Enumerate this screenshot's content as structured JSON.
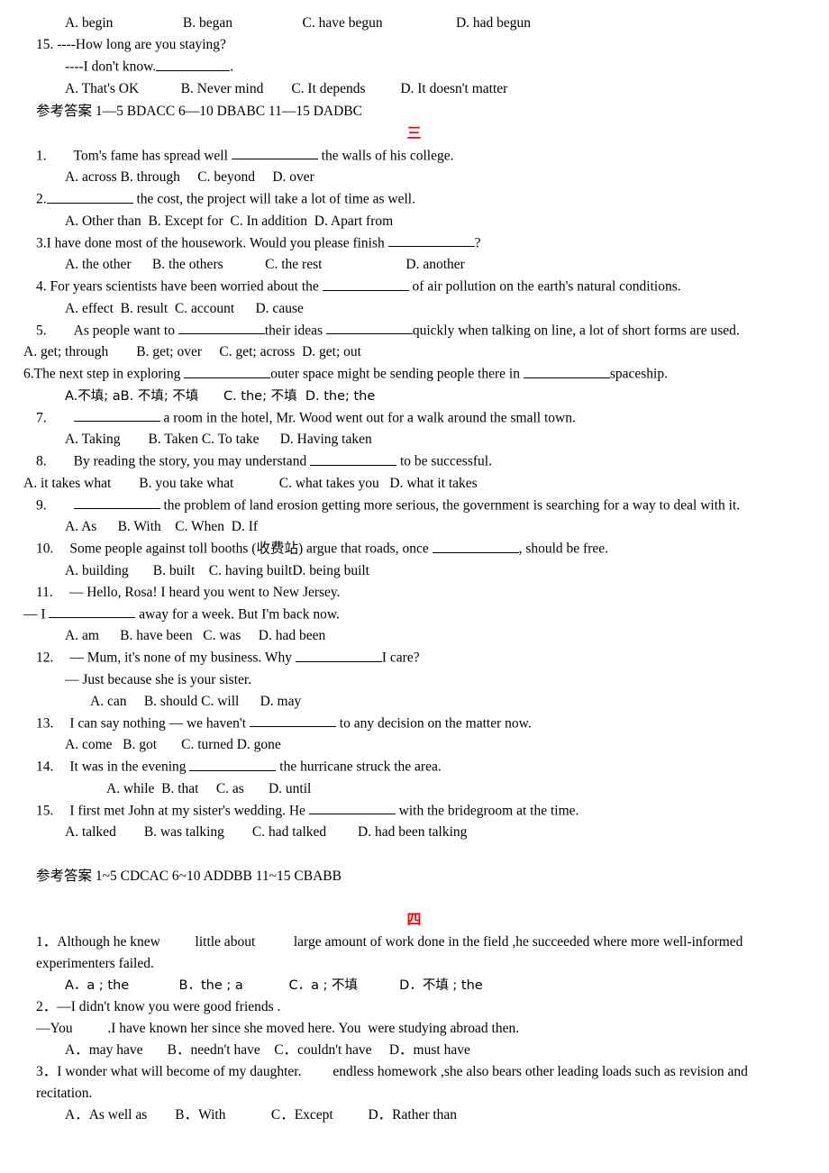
{
  "document": {
    "type": "english-grammar-worksheet",
    "heading_color": "#ff0000",
    "text_color": "#000000",
    "background_color": "#ffffff"
  },
  "top_fragment": {
    "q14_options": "A. begin                    B. began                    C. have begun                     D. had begun",
    "q15_stem": "15. ----How long are you staying?",
    "q15_reply": "----I don't know.",
    "q15_reply_tail": ".",
    "q15_options": "A. That's OK            B. Never mind        C. It depends          D. It doesn't matter",
    "answer_key": "参考答案 1—5 BDACC           6—10 DBABC          11—15 DADBC"
  },
  "section_three": {
    "heading": "三",
    "questions": [
      {
        "number": "1.",
        "stem_before": "Tom's fame has spread well",
        "stem_after": "the walls of his college.",
        "options": "A. across B. through     C. beyond     D. over"
      },
      {
        "number": "2.",
        "stem_before": "",
        "stem_after": "the cost, the project will take a lot of time as well.",
        "options": "A. Other than  B. Except for  C. In addition  D. Apart from"
      },
      {
        "number": "3.",
        "stem_before": "I have done most of the housework. Would you please finish",
        "stem_after": "?",
        "options": "A. the other      B. the others            C. the rest                        D. another"
      },
      {
        "number": "4.",
        "stem_before": "For years scientists have been worried about the",
        "stem_after": "of air pollution on the earth's natural conditions.",
        "options": "A. effect  B. result  C. account      D. cause"
      },
      {
        "number": "5.",
        "stem_before": "As people want to",
        "stem_mid": "their ideas",
        "stem_after": "quickly when talking on line, a lot of short forms are used.",
        "options": "A. get; through        B. get; over     C. get; across  D. get; out"
      },
      {
        "number": "6.",
        "stem_before": "The next step in exploring",
        "stem_mid": "outer space might be sending people there in",
        "stem_after": "spaceship.",
        "options": "A.不填; aB. 不填; 不填      C. the; 不填  D. the; the"
      },
      {
        "number": "7.",
        "stem_before": "",
        "stem_after": "a room in the hotel, Mr. Wood went out for a walk around the small town.",
        "options": "A. Taking        B. Taken C. To take      D. Having taken"
      },
      {
        "number": "8.",
        "stem_before": "By reading the story, you may understand",
        "stem_after": "to be successful.",
        "options": "A. it takes what        B. you take what             C. what takes you   D. what it takes"
      },
      {
        "number": "9.",
        "stem_before": "",
        "stem_after": "the problem of land erosion getting more serious, the government is searching for a way to deal with it.",
        "options": "A. As      B. With    C. When  D. If"
      },
      {
        "number": "10.",
        "stem_before": "Some people against toll booths (收费站) argue that roads, once",
        "stem_after": ", should be free.",
        "options": "A. building       B. built    C. having builtD. being built"
      },
      {
        "number": "11.",
        "stem_dash_1": "— Hello, Rosa! I heard you went to New Jersey.",
        "stem_dash_2_before": "— I",
        "stem_dash_2_after": "away for a week. But I'm back now.",
        "options": "A. am      B. have been   C. was     D. had been"
      },
      {
        "number": "12.",
        "stem_dash_1_before": "— Mum, it's none of my business. Why",
        "stem_dash_1_after": "I care?",
        "stem_dash_2": "— Just because she is your sister.",
        "options": "A. can     B. should C. will      D. may"
      },
      {
        "number": "13.",
        "stem_before": "I can say nothing — we haven't",
        "stem_after": "to any decision on the matter now.",
        "options": "A. come   B. got       C. turned D. gone"
      },
      {
        "number": "14.",
        "stem_before": "It was in the evening",
        "stem_after": "the hurricane struck the area.",
        "options": "A. while  B. that     C. as       D. until"
      },
      {
        "number": "15.",
        "stem_before": "I first met John at my sister's wedding. He",
        "stem_after": "with the bridegroom at the time.",
        "options": "A. talked        B. was talking        C. had talked         D. had been talking"
      }
    ],
    "answer_key": "参考答案 1~5 CDCAC    6~10 ADDBB    11~15 CBABB"
  },
  "section_four": {
    "heading": "四",
    "questions": [
      {
        "number": "1．",
        "stem_line_1": "Although he knew          little about           large amount of work done in the field ,he succeeded where more well-informed",
        "stem_line_2": "experimenters failed.",
        "options": "A．a ; the            B．the ; a           C．a ; 不填          D．不填 ; the"
      },
      {
        "number": "2．",
        "stem_line_1": "—I didn't know you were good friends .",
        "stem_line_2": "—You          .I have known her since she moved here. You  were studying abroad then.",
        "options": "A．may have       B．needn't have    C．couldn't have     D．must have"
      },
      {
        "number": "3．",
        "stem_line_1": "I wonder what will become of my daughter.         endless homework ,she also bears other leading loads such as revision and",
        "stem_line_2": "recitation.",
        "options": "A．As well as        B．With             C．Except          D．Rather than"
      }
    ]
  }
}
